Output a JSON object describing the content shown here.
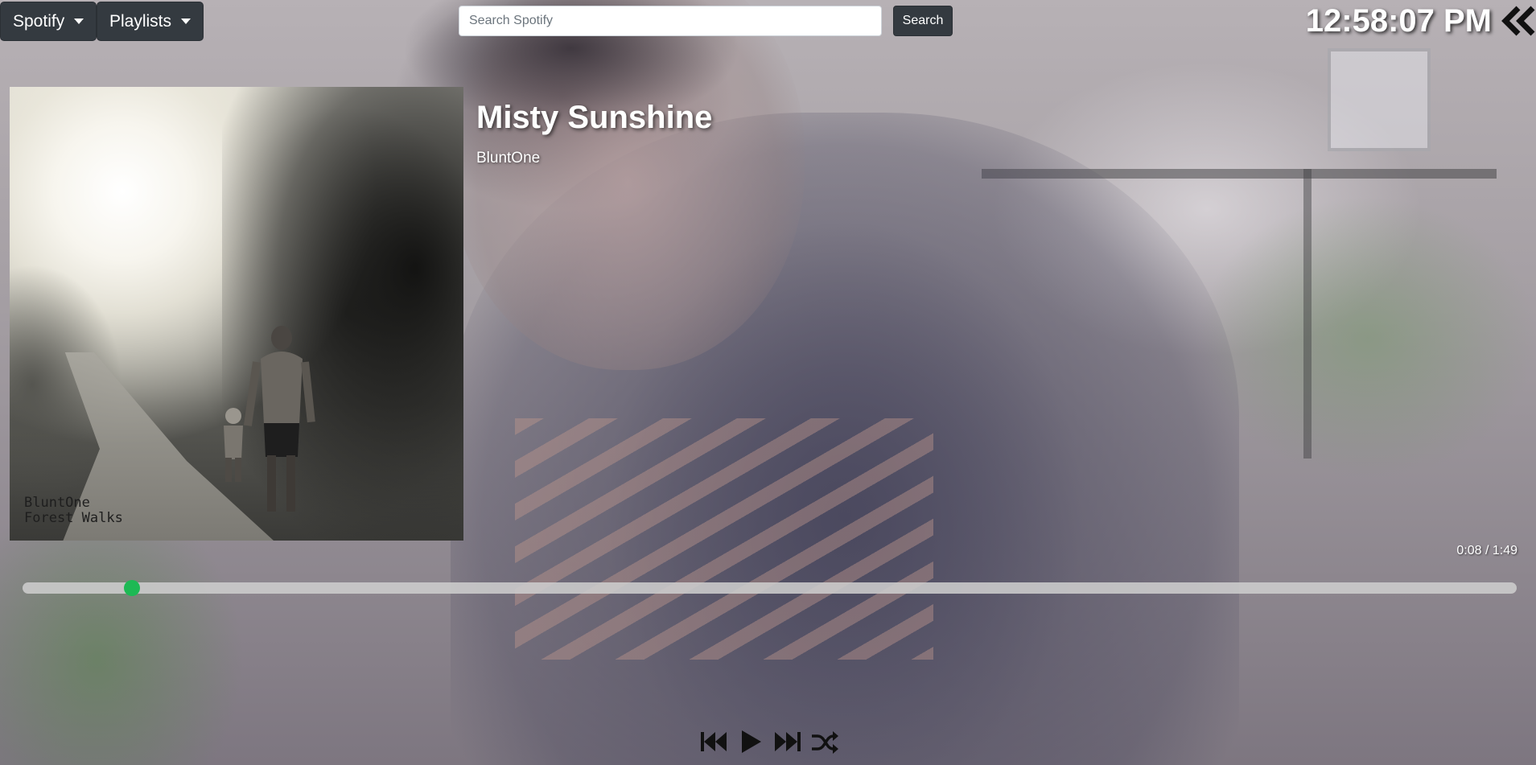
{
  "nav": {
    "spotify_label": "Spotify",
    "playlists_label": "Playlists"
  },
  "search": {
    "placeholder": "Search Spotify",
    "value": "",
    "button_label": "Search"
  },
  "clock": {
    "time": "12:58:07 PM"
  },
  "now_playing": {
    "title": "Misty Sunshine",
    "artist": "BluntOne",
    "album_art_text": "BluntOne\nForest Walks",
    "elapsed": "0:08",
    "duration": "1:49",
    "time_display": "0:08 / 1:49",
    "progress_fraction": 0.073
  },
  "controls": {
    "icons": [
      "skip-previous-icon",
      "play-icon",
      "skip-next-icon",
      "shuffle-icon"
    ]
  },
  "colors": {
    "accent": "#1db954",
    "button_dark": "#343a40"
  }
}
